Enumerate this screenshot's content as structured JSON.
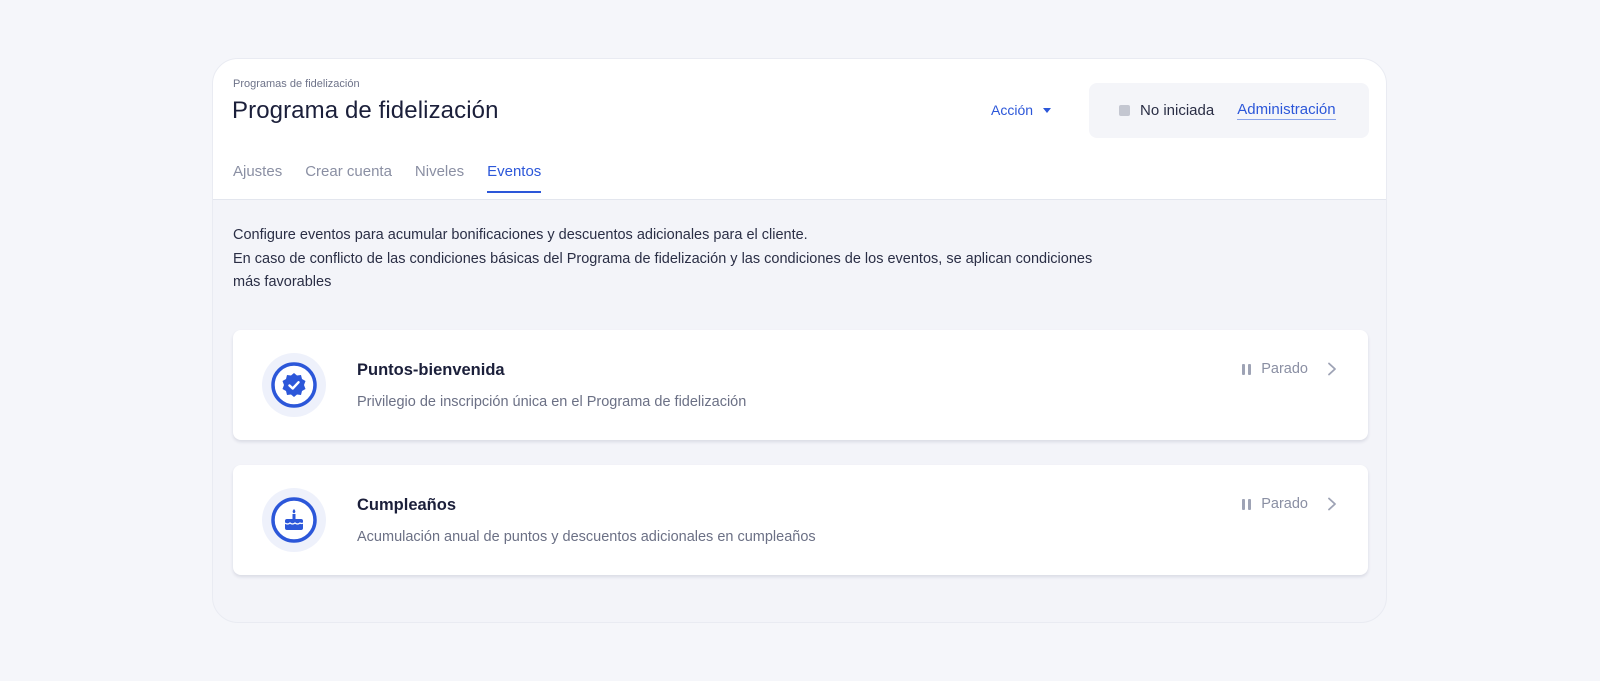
{
  "header": {
    "breadcrumb": "Programas de fidelización",
    "title": "Programa de fidelización",
    "action_label": "Acción",
    "status_label": "No iniciada",
    "admin_link": "Administración"
  },
  "tabs": [
    {
      "label": "Ajustes",
      "active": false
    },
    {
      "label": "Crear cuenta",
      "active": false
    },
    {
      "label": "Niveles",
      "active": false
    },
    {
      "label": "Eventos",
      "active": true
    }
  ],
  "description": {
    "line1": "Configure eventos para acumular bonificaciones y descuentos adicionales para el cliente.",
    "line2": "En caso de conflicto de las condiciones básicas del Programa de fidelización y las condiciones de los eventos, se aplican condiciones más favorables"
  },
  "events": [
    {
      "icon": "badge-check-icon",
      "title": "Puntos-bienvenida",
      "subtitle": "Privilegio de inscripción única en el Programa de fidelización",
      "status": "Parado"
    },
    {
      "icon": "birthday-cake-icon",
      "title": "Cumpleaños",
      "subtitle": "Acumulación anual de puntos y descuentos adicionales en cumpleaños",
      "status": "Parado"
    }
  ],
  "colors": {
    "accent": "#2c57d9",
    "background": "#f5f6fa",
    "text": "#1b1f3a"
  }
}
